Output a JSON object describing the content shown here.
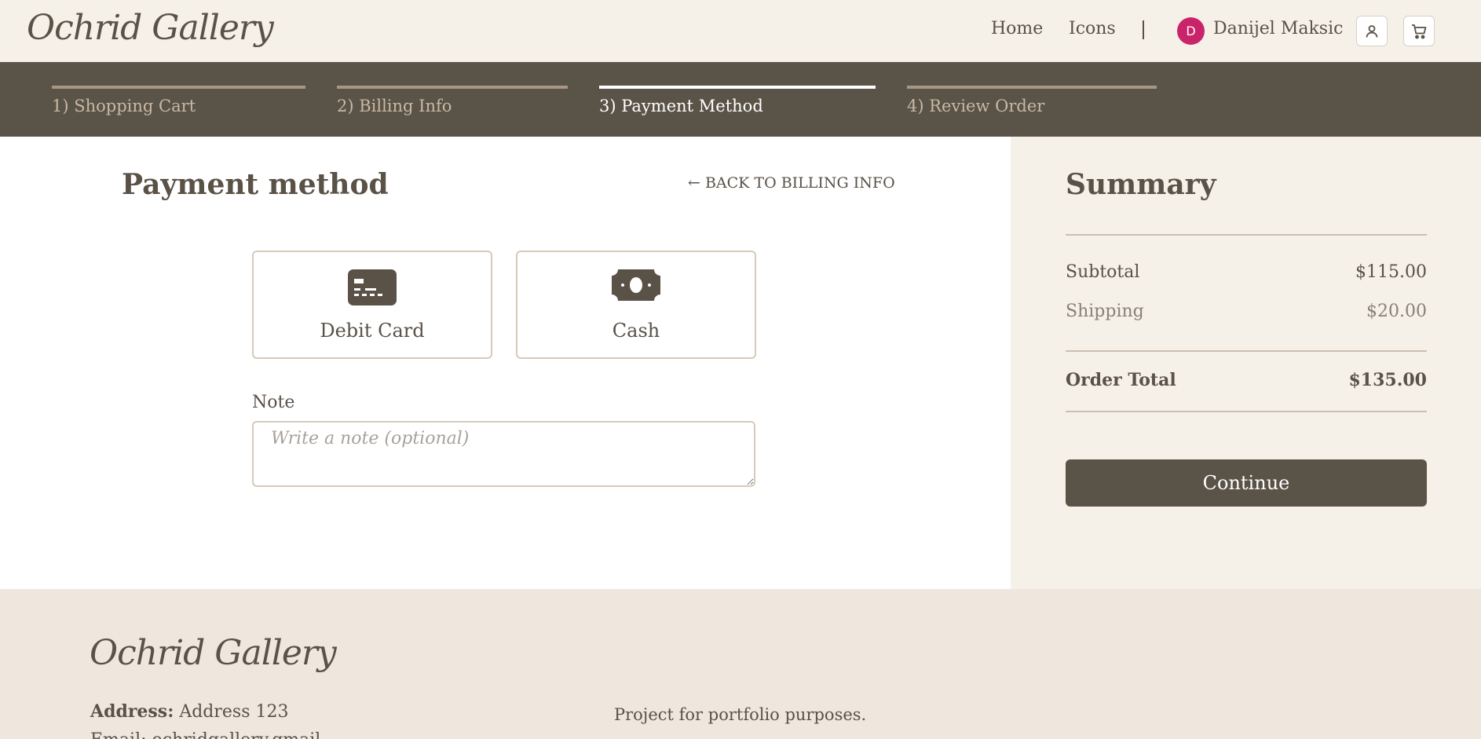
{
  "header": {
    "logo": "Ochrid Gallery",
    "nav": {
      "home": "Home",
      "icons": "Icons"
    },
    "user": {
      "initial": "D",
      "name": "Danijel Maksic"
    },
    "buttons": {
      "user_icon": "user-icon",
      "cart_icon": "cart-icon"
    }
  },
  "stepper": {
    "steps": [
      {
        "label": "1) Shopping Cart",
        "active": false
      },
      {
        "label": "2) Billing Info",
        "active": false
      },
      {
        "label": "3) Payment Method",
        "active": true
      },
      {
        "label": "4) Review Order",
        "active": false
      }
    ]
  },
  "main": {
    "title": "Payment method",
    "back_link": "← BACK TO BILLING INFO",
    "methods": [
      {
        "label": "Debit Card",
        "icon": "credit-card-icon"
      },
      {
        "label": "Cash",
        "icon": "cash-icon"
      }
    ],
    "note": {
      "label": "Note",
      "placeholder": "Write a note (optional)",
      "value": ""
    }
  },
  "summary": {
    "title": "Summary",
    "subtotal_label": "Subtotal",
    "subtotal_value": "$115.00",
    "shipping_label": "Shipping",
    "shipping_value": "$20.00",
    "total_label": "Order Total",
    "total_value": "$135.00",
    "continue_label": "Continue"
  },
  "footer": {
    "logo": "Ochrid Gallery",
    "address_label": "Address:",
    "address_value": "Address 123",
    "email_partial": "Email: ochridgallery.gmail",
    "note": "Project for portfolio purposes."
  },
  "colors": {
    "header_bg": "#f5f0e8",
    "stepper_bg": "#5a5347",
    "accent_text": "#5a5147",
    "avatar_bg": "#c9246a",
    "button_bg": "#5a5347",
    "footer_bg": "#efe7de"
  }
}
